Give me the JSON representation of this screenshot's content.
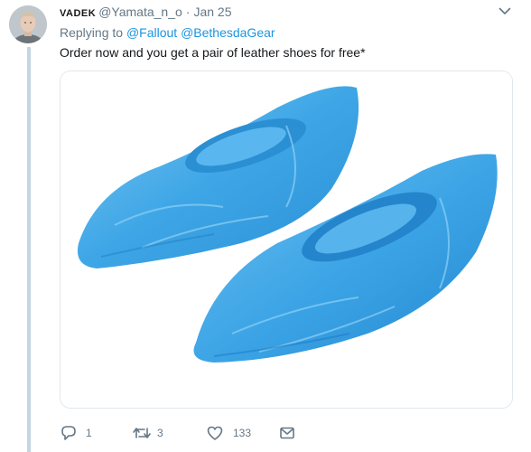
{
  "tweet": {
    "display_name": "VADEK",
    "handle": "@Yamata_n_o",
    "separator": "·",
    "date": "Jan 25",
    "replying_prefix": "Replying to",
    "replying_to": [
      "@Fallout",
      "@BethesdaGear"
    ],
    "text": "Order now and you get a pair of leather shoes for free*"
  },
  "media": {
    "description_icon": "blue-plastic-shoe-covers-photo"
  },
  "actions": {
    "reply_count": "1",
    "retweet_count": "3",
    "like_count": "133"
  },
  "colors": {
    "link": "#1b95e0",
    "muted": "#657786",
    "thread_line": "#c4d6e2",
    "shoe_cover": "#3ea6e6"
  }
}
